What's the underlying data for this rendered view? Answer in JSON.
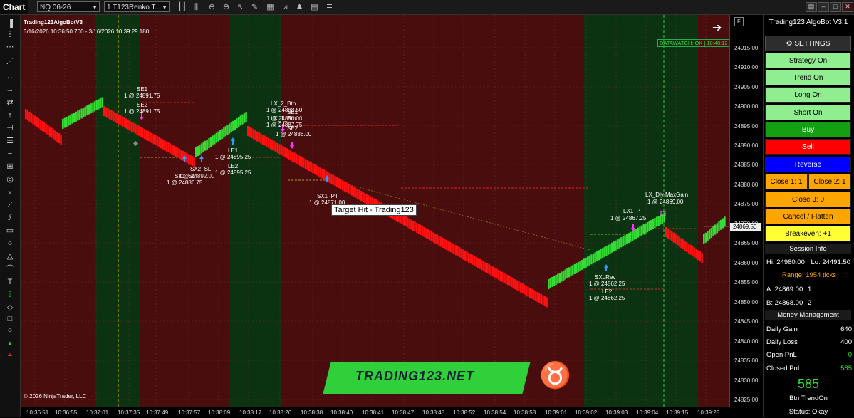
{
  "toolbar": {
    "tab_label": "Chart",
    "instrument": "NQ 06-26",
    "bar_type": "1 T123Renko T..."
  },
  "chart": {
    "strategy_name": "Trading123AlgoBotV3",
    "date_range": "3/16/2026 10:36:50.700 - 3/16/2026 10:39:29.180",
    "datawatch": "DATAWATCH: OK | 10:48:12",
    "copyright": "© 2026 NinjaTrader, LLC",
    "watermark": "TRADING123.NET",
    "target_tooltip": "Target Hit - Trading123",
    "current_price": "24869.50",
    "colors": {
      "up_brick": "#33dd33",
      "down_brick": "#ff1111",
      "bg_red": "#4a0d0d",
      "bg_green": "#0c3311"
    },
    "annotations": [
      {
        "id": "se1",
        "text": "SE1"
      },
      {
        "id": "se1p",
        "text": "1 @ 24891.75"
      },
      {
        "id": "se2",
        "text": "SE2"
      },
      {
        "id": "se2p",
        "text": "1 @ 24891.75"
      },
      {
        "id": "sx2",
        "text": "SX2_SL"
      },
      {
        "id": "sx1",
        "text": "SX1_SL"
      },
      {
        "id": "sx2p",
        "text": "1 @ 24892.00"
      },
      {
        "id": "sx1p",
        "text": "1 @ 24886.75"
      },
      {
        "id": "le1",
        "text": "LE1"
      },
      {
        "id": "le1p",
        "text": "1 @ 24895.25"
      },
      {
        "id": "le2",
        "text": "LE2"
      },
      {
        "id": "le2p",
        "text": "1 @ 24895.25"
      },
      {
        "id": "lx2",
        "text": "LX_2_Btn"
      },
      {
        "id": "lx2p",
        "text": "1 @ 24888.50"
      },
      {
        "id": "lxbtn",
        "text": "LX_1_Btn"
      },
      {
        "id": "lxbtnp",
        "text": "1 @ 24886.00"
      },
      {
        "id": "se1b",
        "text": "SE1"
      },
      {
        "id": "se1bp",
        "text": "1 @ 24887.75"
      },
      {
        "id": "se2b",
        "text": "SE2"
      },
      {
        "id": "se2bp",
        "text": "1 @ 24886.00"
      },
      {
        "id": "sx1pt",
        "text": "SX1_PT"
      },
      {
        "id": "sx1ptp",
        "text": "1 @ 24871.00"
      },
      {
        "id": "lx1pt",
        "text": "LX1_PT"
      },
      {
        "id": "lx1ptp",
        "text": "1 @ 24867.25"
      },
      {
        "id": "lxdly",
        "text": "LX_Dly MaxGain"
      },
      {
        "id": "lxdlyp",
        "text": "1 @ 24869.00"
      },
      {
        "id": "sxrev",
        "text": "SXLRev"
      },
      {
        "id": "sxrevp",
        "text": "1 @ 24862.25"
      },
      {
        "id": "le2b",
        "text": "LE2"
      },
      {
        "id": "le2bp",
        "text": "1 @ 24862.25"
      }
    ]
  },
  "y_axis": [
    "24915.00",
    "24910.00",
    "24905.00",
    "24900.00",
    "24895.00",
    "24890.00",
    "24885.00",
    "24880.00",
    "24875.00",
    "24870.00",
    "24865.00",
    "24860.00",
    "24855.00",
    "24850.00",
    "24845.00",
    "24840.00",
    "24835.00",
    "24830.00",
    "24825.00"
  ],
  "x_axis": [
    "10:36:51",
    "10:36:55",
    "10:37:01",
    "10:37:35",
    "10:37:49",
    "10:37:57",
    "10:38:09",
    "10:38:17",
    "10:38:26",
    "10:38:38",
    "10:38:40",
    "10:38:41",
    "10:38:47",
    "10:38:48",
    "10:38:52",
    "10:38:54",
    "10:38:58",
    "10:39:01",
    "10:39:02",
    "10:39:03",
    "10:39:04",
    "10:39:15",
    "10:39:25"
  ],
  "panel": {
    "title": "Trading123 AlgoBot V3.1",
    "settings": "SETTINGS",
    "strategy_on": "Strategy On",
    "trend_on": "Trend On",
    "long_on": "Long On",
    "short_on": "Short On",
    "buy": "Buy",
    "sell": "Sell",
    "reverse": "Reverse",
    "close1": "Close 1:  1",
    "close2": "Close 2:  1",
    "close3": "Close 3:  0",
    "cancel_flatten": "Cancel / Flatten",
    "breakeven": "Breakeven:  +1",
    "session_info": "Session Info",
    "hi": "Hi: 24980.00",
    "lo": "Lo: 24491.50",
    "range": "Range: 1954 ticks",
    "a_price": "A: 24869.00",
    "a_qty": "1",
    "b_price": "B: 24868.00",
    "b_qty": "2",
    "money_mgmt": "Money Management",
    "daily_gain_label": "Daily Gain",
    "daily_gain_value": "640",
    "daily_loss_label": "Daily Loss",
    "daily_loss_value": "400",
    "open_pnl_label": "Open PnL",
    "open_pnl_value": "0",
    "closed_pnl_label": "Closed PnL",
    "closed_pnl_value": "585",
    "big_number": "585",
    "btn_trendon": "Btn TrendOn",
    "status": "Status: Okay"
  }
}
